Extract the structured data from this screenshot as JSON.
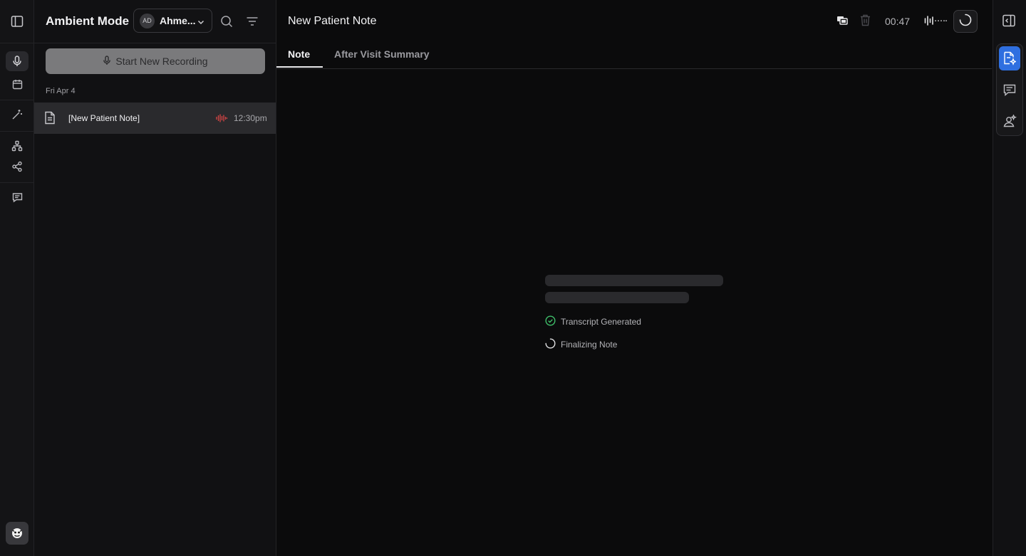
{
  "app": {
    "title": "Ambient Mode"
  },
  "user": {
    "initials": "AD",
    "name": "Ahme..."
  },
  "sidebar": {
    "record_button": "Start New Recording",
    "date_group": "Fri Apr 4",
    "items": [
      {
        "title": "[New Patient Note]",
        "time": "12:30pm"
      }
    ]
  },
  "main": {
    "title": "New Patient Note",
    "timer": "00:47",
    "tabs": [
      {
        "label": "Note",
        "active": true
      },
      {
        "label": "After Visit Summary",
        "active": false
      }
    ],
    "status": [
      {
        "label": "Transcript Generated",
        "state": "done"
      },
      {
        "label": "Finalizing Note",
        "state": "loading"
      }
    ]
  },
  "colors": {
    "accent": "#2f6fe0",
    "success": "#3fbf6a",
    "recording": "#d64545",
    "background": "#0b0b0c"
  },
  "icons": [
    "sidebar-toggle-icon",
    "mic-icon",
    "calendar-icon",
    "magic-wand-icon",
    "hierarchy-icon",
    "share-icon",
    "chat-icon",
    "bot-avatar-icon",
    "search-icon",
    "filter-icon",
    "chevron-down-icon",
    "document-icon",
    "waveform-icon",
    "copy-icon",
    "trash-icon",
    "audio-level-icon",
    "spinner-icon",
    "panel-right-icon",
    "note-sparkle-icon",
    "message-icon",
    "assistant-icon",
    "check-circle-icon"
  ]
}
